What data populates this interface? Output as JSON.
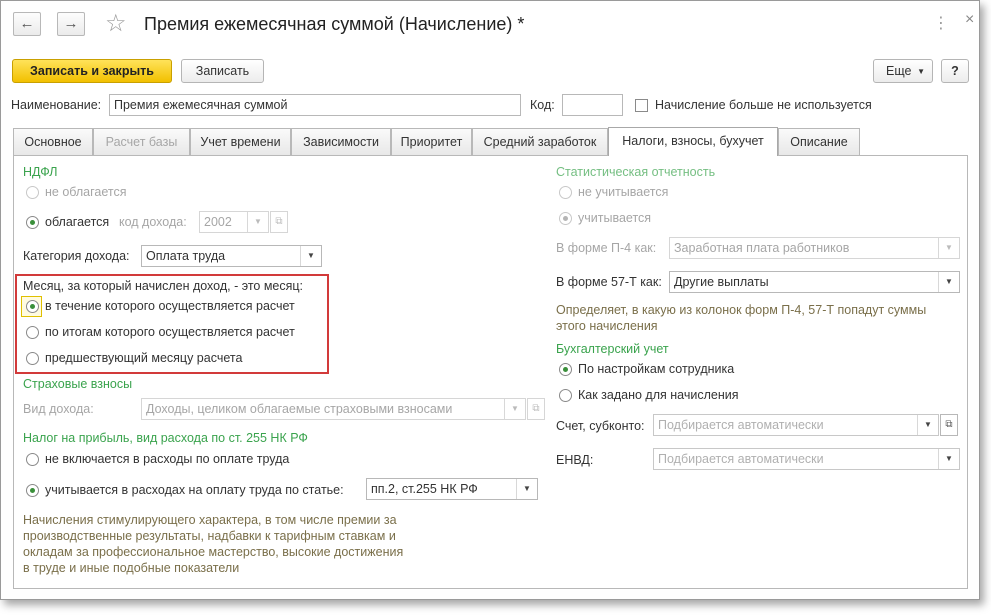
{
  "title": "Премия ежемесячная суммой (Начисление) *",
  "toolbar": {
    "save_close": "Записать и закрыть",
    "save": "Записать",
    "more": "Еще",
    "help": "?"
  },
  "header": {
    "name_label": "Наименование:",
    "name_value": "Премия ежемесячная суммой",
    "code_label": "Код:",
    "code_value": "",
    "unused_label": "Начисление больше не используется"
  },
  "tabs": [
    "Основное",
    "Расчет базы",
    "Учет времени",
    "Зависимости",
    "Приоритет",
    "Средний заработок",
    "Налоги, взносы, бухучет",
    "Описание"
  ],
  "ndfl": {
    "heading": "НДФЛ",
    "not_taxed": "не облагается",
    "taxed": "облагается",
    "income_code_label": "код дохода:",
    "income_code_value": "2002",
    "category_label": "Категория дохода:",
    "category_value": "Оплата труда"
  },
  "month": {
    "label": "Месяц, за который начислен доход, - это месяц:",
    "opt1": "в течение которого осуществляется расчет",
    "opt2": "по итогам которого осуществляется расчет",
    "opt3": "предшествующий месяцу расчета"
  },
  "insurance": {
    "heading": "Страховые взносы",
    "income_type_label": "Вид дохода:",
    "income_type_value": "Доходы, целиком облагаемые страховыми взносами"
  },
  "profit_tax": {
    "heading": "Налог на прибыль, вид расхода по ст. 255 НК РФ",
    "not_included": "не включается в расходы по оплате труда",
    "included": "учитывается в расходах на оплату труда по статье:",
    "article_value": "пп.2, ст.255 НК РФ",
    "description": [
      "Начисления стимулирующего характера, в том числе премии за",
      "производственные результаты, надбавки к тарифным ставкам и",
      "окладам за профессиональное мастерство, высокие достижения",
      "в труде и иные подобные показатели"
    ]
  },
  "stat": {
    "heading": "Статистическая отчетность",
    "not_counted": "не учитывается",
    "counted": "учитывается",
    "p4_label": "В форме П-4 как:",
    "p4_value": "Заработная плата работников",
    "t57_label": "В форме 57-Т как:",
    "t57_value": "Другие выплаты",
    "description": [
      "Определяет, в какую из колонок форм П-4, 57-Т попадут суммы",
      "этого начисления"
    ]
  },
  "accounting": {
    "heading": "Бухгалтерский учет",
    "by_employee": "По настройкам сотрудника",
    "by_accrual": "Как задано для начисления",
    "account_label": "Счет, субконто:",
    "account_placeholder": "Подбирается автоматически",
    "envd_label": "ЕНВД:",
    "envd_placeholder": "Подбирается автоматически"
  },
  "colors": {
    "accent_green": "#3aa34d",
    "primary_button": "#f2c000",
    "highlight_red": "#d23a3a"
  }
}
